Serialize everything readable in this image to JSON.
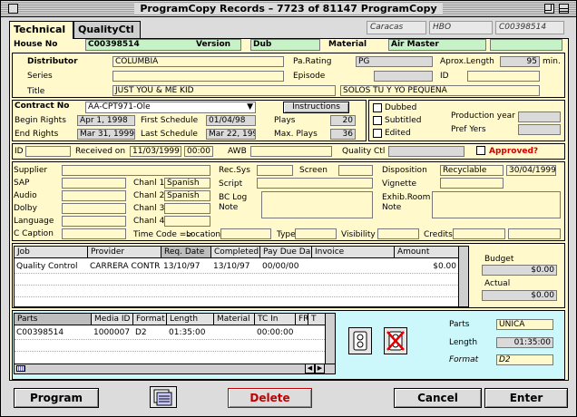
{
  "window": {
    "title": "ProgramCopy Records – 7723 of 81147 ProgramCopy"
  },
  "tabs": {
    "technical": "Technical",
    "qualityctl": "QualityCtl"
  },
  "header": {
    "box1": "Caracas",
    "box2": "HBO",
    "box3": "C00398514"
  },
  "top": {
    "house_no_label": "House No",
    "house_no": "C00398514",
    "version_label": "Version",
    "version": "Dub",
    "material_label": "Material",
    "material": "Air Master"
  },
  "info": {
    "distributor_label": "Distributor",
    "distributor": "COLUMBIA",
    "pa_rating_label": "Pa.Rating",
    "pa_rating": "PG",
    "aprox_length_label": "Aprox.Length",
    "aprox_length": "95",
    "min_label": "min.",
    "series_label": "Series",
    "episode_label": "Episode",
    "id_label": "ID",
    "title_label": "Title",
    "title": "JUST YOU & ME KID",
    "title_local": "SOLOS TU Y YO PEQUEÑA"
  },
  "contract": {
    "contract_no_label": "Contract No",
    "contract_no": "AA-CPT971-Ole",
    "instructions": "Instructions",
    "begin_rights_label": "Begin Rights",
    "begin_rights": "Apr 1, 1998",
    "first_schedule_label": "First Schedule",
    "first_schedule": "01/04/98",
    "plays_label": "Plays",
    "plays": "20",
    "end_rights_label": "End Rights",
    "end_rights": "Mar 31, 1999",
    "last_schedule_label": "Last Schedule",
    "last_schedule": "Mar 22, 1999",
    "max_plays_label": "Max. Plays",
    "max_plays": "36"
  },
  "options": {
    "dubbed": "Dubbed",
    "subtitled": "Subtitled",
    "edited": "Edited",
    "production_year_label": "Production year",
    "pref_yers_label": "Pref Yers"
  },
  "receive": {
    "id_label": "ID",
    "received_on_label": "Received on",
    "received_date": "11/03/1999",
    "received_time": "00:00",
    "awb_label": "AWB",
    "quality_ctl_label": "Quality Ctl",
    "approved_label": "Approved?"
  },
  "tech": {
    "supplier": "Supplier",
    "sap": "SAP",
    "audio": "Audio",
    "dolby": "Dolby",
    "language": "Language",
    "c_caption": "C Caption",
    "chanl1_label": "Chanl 1",
    "chanl1": "Spanish",
    "chanl2_label": "Chanl 2",
    "chanl2": "Spanish",
    "chanl3_label": "Chanl 3",
    "chanl4_label": "Chanl 4",
    "rec_sys": "Rec.Sys",
    "screen": "Screen",
    "script": "Script",
    "bc_log_note": "BC Log",
    "bc_log_note2": "Note",
    "disposition_label": "Disposition",
    "disposition": "Recyclable",
    "disposition_date": "30/04/1999",
    "vignette": "Vignette",
    "exhib_room": "Exhib.Room",
    "exhib_note": "Note",
    "time_code": "Time Code =>",
    "location": "Location",
    "type": "Type",
    "visibility": "Visibility",
    "credits": "Credits"
  },
  "jobs": {
    "columns": [
      "Job",
      "Provider",
      "Req. Date",
      "Completed",
      "Pay Due Da",
      "Invoice",
      "Amount"
    ],
    "rows": [
      [
        "Quality Control",
        "CARRERA CONTR",
        "13/10/97",
        "13/10/97",
        "00/00/00",
        "",
        "$0.00"
      ]
    ],
    "budget_label": "Budget",
    "budget": "$0.00",
    "actual_label": "Actual",
    "actual": "$0.00"
  },
  "parts": {
    "columns": [
      "Parts",
      "Media ID",
      "Format",
      "Length",
      "Material",
      "TC In",
      "FR",
      "T"
    ],
    "rows": [
      [
        "C00398514",
        "1000007",
        "D2",
        "01:35:00",
        "",
        "00:00:00",
        "",
        ""
      ]
    ],
    "parts_label": "Parts",
    "parts_value": "UNICA",
    "length_label": "Length",
    "length_value": "01:35:00",
    "format_label": "Format",
    "format_value": "D2"
  },
  "buttons": {
    "program": "Program",
    "delete": "Delete",
    "cancel": "Cancel",
    "enter": "Enter"
  }
}
